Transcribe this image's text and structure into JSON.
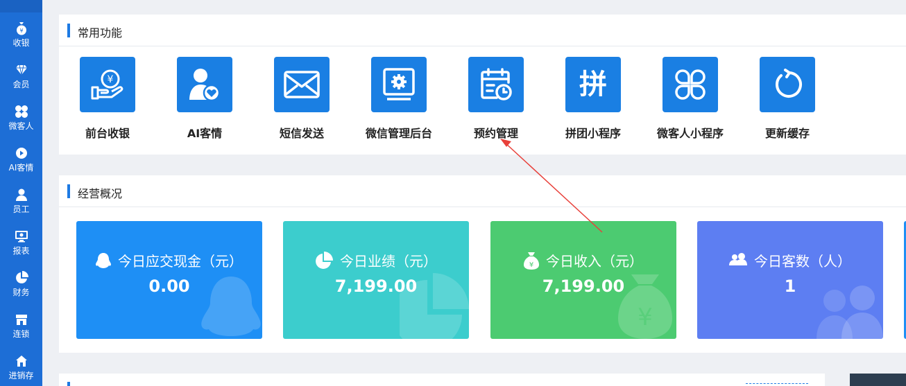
{
  "sidebar": {
    "items": [
      {
        "label": "收银",
        "icon": "money-bag-icon"
      },
      {
        "label": "会员",
        "icon": "diamond-icon"
      },
      {
        "label": "微客人",
        "icon": "clover-icon"
      },
      {
        "label": "AI客情",
        "icon": "play-icon"
      },
      {
        "label": "员工",
        "icon": "user-icon"
      },
      {
        "label": "报表",
        "icon": "monitor-icon"
      },
      {
        "label": "财务",
        "icon": "pie-icon"
      },
      {
        "label": "连锁",
        "icon": "store-icon"
      },
      {
        "label": "进销存",
        "icon": "home-icon"
      }
    ]
  },
  "common_functions": {
    "title": "常用功能",
    "items": [
      {
        "label": "前台收银",
        "icon": "cash-hand-icon"
      },
      {
        "label": "AI客情",
        "icon": "user-heart-icon"
      },
      {
        "label": "短信发送",
        "icon": "envelope-icon"
      },
      {
        "label": "微信管理后台",
        "icon": "monitor-gear-icon"
      },
      {
        "label": "预约管理",
        "icon": "calendar-clock-icon"
      },
      {
        "label": "拼团小程序",
        "icon": "pin-character-icon",
        "glyph": "拼"
      },
      {
        "label": "微客人小程序",
        "icon": "clover-outline-icon"
      },
      {
        "label": "更新缓存",
        "icon": "refresh-icon"
      }
    ]
  },
  "business_overview": {
    "title": "经营概况",
    "cards": [
      {
        "title": "今日应交现金（元）",
        "value": "0.00",
        "icon": "penguin-icon",
        "color": "#1e8ff5"
      },
      {
        "title": "今日业绩（元）",
        "value": "7,199.00",
        "icon": "pie-chart-icon",
        "color": "#3ccdcd"
      },
      {
        "title": "今日收入（元）",
        "value": "7,199.00",
        "icon": "money-bag-icon",
        "color": "#4ccb71"
      },
      {
        "title": "今日客数（人）",
        "value": "1",
        "icon": "users-icon",
        "color": "#5d7ef2"
      }
    ]
  }
}
